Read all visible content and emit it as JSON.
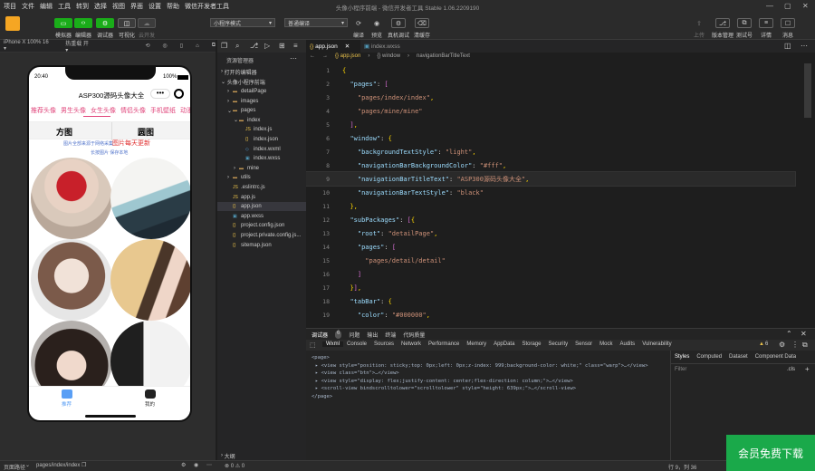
{
  "window": {
    "title": "头像小程序前端 - 微信开发者工具 Stable 1.06.2209190",
    "menu": [
      "项目",
      "文件",
      "编辑",
      "工具",
      "转到",
      "选择",
      "视图",
      "界面",
      "设置",
      "帮助",
      "微信开发者工具"
    ]
  },
  "toolbar": {
    "left_buttons": [
      "模拟器",
      "编辑器",
      "调试器",
      "可视化",
      "云开发"
    ],
    "mode_select": "小程序模式",
    "compile_select": "普通编译",
    "middle_buttons": [
      "编译",
      "预览",
      "真机调试",
      "清缓存"
    ],
    "right_buttons": [
      "上传",
      "版本管理",
      "测试号",
      "详情",
      "消息"
    ]
  },
  "simulator": {
    "device": "iPhone X 100% 16 ▾",
    "hot_reload": "热重载 开 ▾",
    "status_time": "20:40",
    "battery": "100%",
    "nav_title": "ASP300源码头像大全",
    "categories": [
      "推荐头像",
      "男生头像",
      "女生头像",
      "情侣头像",
      "手机壁纸",
      "动漫头像"
    ],
    "tabs": [
      "方图",
      "圆图"
    ],
    "notice_line1": "图片全部来源于网络采集",
    "notice_highlight": "图片每天更新",
    "notice_line2": "长按图片 保存本地",
    "bottom_tabs": [
      "推荐",
      "我的"
    ]
  },
  "explorer": {
    "header": "资源管理器",
    "open_editors": "打开的编辑器",
    "project": "头像小程序前端",
    "items": [
      {
        "label": "detailPage",
        "kind": "folder",
        "indent": 1,
        "arrow": "›"
      },
      {
        "label": "images",
        "kind": "folder",
        "indent": 1,
        "arrow": "›"
      },
      {
        "label": "pages",
        "kind": "folder",
        "indent": 1,
        "arrow": "⌄"
      },
      {
        "label": "index",
        "kind": "folder",
        "indent": 2,
        "arrow": "⌄"
      },
      {
        "label": "index.js",
        "kind": "js",
        "indent": 3,
        "arrow": ""
      },
      {
        "label": "index.json",
        "kind": "json",
        "indent": 3,
        "arrow": ""
      },
      {
        "label": "index.wxml",
        "kind": "wxml",
        "indent": 3,
        "arrow": ""
      },
      {
        "label": "index.wxss",
        "kind": "wxss",
        "indent": 3,
        "arrow": ""
      },
      {
        "label": "mine",
        "kind": "folder",
        "indent": 2,
        "arrow": "›"
      },
      {
        "label": "utils",
        "kind": "folder",
        "indent": 1,
        "arrow": "›"
      },
      {
        "label": ".eslintrc.js",
        "kind": "js",
        "indent": 1,
        "arrow": ""
      },
      {
        "label": "app.js",
        "kind": "js",
        "indent": 1,
        "arrow": ""
      },
      {
        "label": "app.json",
        "kind": "json",
        "indent": 1,
        "arrow": "",
        "selected": true
      },
      {
        "label": "app.wxss",
        "kind": "wxss",
        "indent": 1,
        "arrow": ""
      },
      {
        "label": "project.config.json",
        "kind": "json",
        "indent": 1,
        "arrow": ""
      },
      {
        "label": "project.private.config.js...",
        "kind": "json",
        "indent": 1,
        "arrow": ""
      },
      {
        "label": "sitemap.json",
        "kind": "json",
        "indent": 1,
        "arrow": ""
      }
    ],
    "outline": "大纲"
  },
  "editor": {
    "tabs": [
      "app.json",
      "index.wxss"
    ],
    "breadcrumb": [
      "{} app.json",
      "{} window",
      "navigationBarTitleText"
    ],
    "lines": [
      {
        "n": "1",
        "t": "{"
      },
      {
        "n": "2",
        "t": "  \"pages\": ["
      },
      {
        "n": "3",
        "t": "    \"pages/index/index\","
      },
      {
        "n": "4",
        "t": "    \"pages/mine/mine\""
      },
      {
        "n": "5",
        "t": "  ],"
      },
      {
        "n": "6",
        "t": "  \"window\": {"
      },
      {
        "n": "7",
        "t": "    \"backgroundTextStyle\": \"light\","
      },
      {
        "n": "8",
        "t": "    \"navigationBarBackgroundColor\": \"#fff\","
      },
      {
        "n": "9",
        "t": "    \"navigationBarTitleText\": \"ASP300源码头像大全\","
      },
      {
        "n": "10",
        "t": "    \"navigationBarTextStyle\": \"black\""
      },
      {
        "n": "11",
        "t": "  },"
      },
      {
        "n": "12",
        "t": "  \"subPackages\": [{"
      },
      {
        "n": "13",
        "t": "    \"root\": \"detailPage\","
      },
      {
        "n": "14",
        "t": "    \"pages\": ["
      },
      {
        "n": "15",
        "t": "      \"pages/detail/detail\""
      },
      {
        "n": "16",
        "t": "    ]"
      },
      {
        "n": "17",
        "t": "  }],"
      },
      {
        "n": "18",
        "t": "  \"tabBar\": {"
      },
      {
        "n": "19",
        "t": "    \"color\": \"#000000\","
      }
    ]
  },
  "devtools": {
    "top_tabs": [
      "调试器",
      "6",
      "问题",
      "输出",
      "终端",
      "代码质量"
    ],
    "tabs": [
      "Wxml",
      "Console",
      "Sources",
      "Network",
      "Performance",
      "Memory",
      "AppData",
      "Storage",
      "Security",
      "Sensor",
      "Mock",
      "Audits",
      "Vulnerability"
    ],
    "warn_count": "6",
    "right_tabs": [
      "Styles",
      "Computed",
      "Dataset",
      "Component Data"
    ],
    "filter": "Filter",
    "cls": ".cls",
    "dom_lines": [
      "<page>",
      "▸ <view style=\"position: sticky;top: 0px;left: 0px;z-index: 999;background-color: white;\" class=\"warp\">…</view>",
      "▸ <view class=\"btn\">…</view>",
      "▸ <view style=\"display: flex;justify-content: center;flex-direction: column;\">…</view>",
      "▸ <scroll-view bindscrolltolower=\"scrolltolower\" style=\"height: 639px;\">…</scroll-view>",
      "</page>"
    ]
  },
  "statusbar": {
    "path_label": "页面路径",
    "path": "pages/index/index",
    "issues": "⊗ 0 ⚠ 0",
    "position": "行 9，列 36"
  },
  "promo": "会员免费下载",
  "colors": {
    "accent": "#1aad19",
    "keyword": "#9cdcfe",
    "string": "#ce9178",
    "pink": "#e0457b"
  }
}
